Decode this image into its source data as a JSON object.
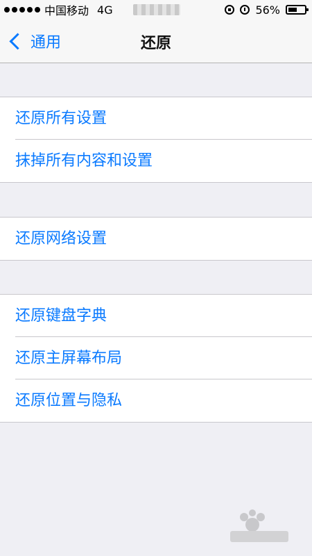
{
  "status_bar": {
    "carrier": "中国移动",
    "network": "4G",
    "battery_percent_text": "56%",
    "battery_level": 0.56
  },
  "nav": {
    "back_label": "通用",
    "title": "还原"
  },
  "groups": [
    {
      "items": [
        {
          "label": "还原所有设置"
        },
        {
          "label": "抹掉所有内容和设置"
        }
      ]
    },
    {
      "items": [
        {
          "label": "还原网络设置"
        }
      ]
    },
    {
      "items": [
        {
          "label": "还原键盘字典"
        },
        {
          "label": "还原主屏幕布局"
        },
        {
          "label": "还原位置与隐私"
        }
      ]
    }
  ],
  "colors": {
    "accent": "#0a7aff",
    "background": "#efeff4"
  }
}
